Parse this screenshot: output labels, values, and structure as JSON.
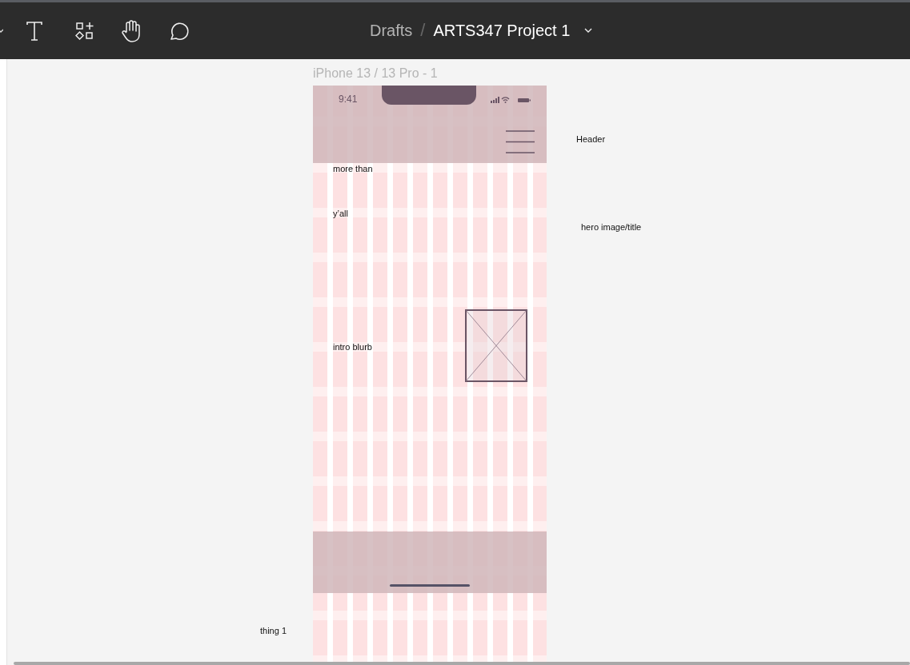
{
  "toolbar": {
    "breadcrumb_parent": "Drafts",
    "breadcrumb_separator": "/",
    "file_title": "ARTS347 Project 1"
  },
  "frame": {
    "label": "iPhone 13 / 13 Pro - 1",
    "status_time": "9:41",
    "texts": [
      {
        "text": "more than"
      },
      {
        "text": "y’all"
      },
      {
        "text": "intro blurb"
      }
    ]
  },
  "annotations": [
    {
      "text": "Header"
    },
    {
      "text": "hero image/title"
    },
    {
      "text": "thing 1"
    }
  ]
}
